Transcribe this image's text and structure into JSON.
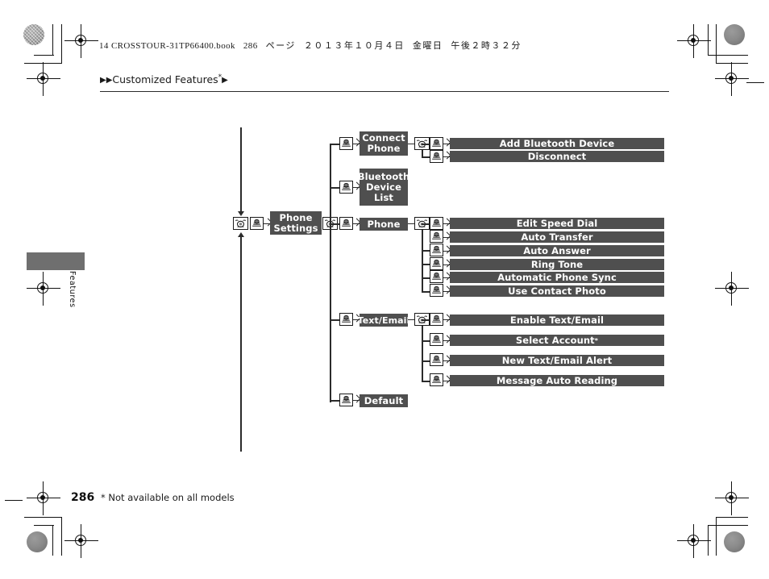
{
  "header": {
    "book_file": "14 CROSSTOUR-31TP66400.book",
    "page_label": "286",
    "page_unit_jp": "ページ",
    "date_jp": "２０１３年１０月４日",
    "weekday_jp": "金曜日",
    "time_jp": "午後２時３２分",
    "breadcrumb_prefix": "▶▶",
    "breadcrumb_title": "Customized Features",
    "breadcrumb_star": "*",
    "breadcrumb_suffix": "▶"
  },
  "side_tab": {
    "label": "Features"
  },
  "footer": {
    "page_number": "286",
    "footnote": "* Not available on all models"
  },
  "colors": {
    "node_fill": "#4f4f4f",
    "node_text": "#ffffff",
    "line": "#2b2b2b",
    "side_tab": "#6f6f6f"
  },
  "icons": {
    "dial": "rotary-dial-knob-icon",
    "push": "push-select-knob-icon",
    "chevron": "chevron-right-arrow-icon",
    "arrow_down": "arrow-down-icon",
    "arrow_up": "arrow-up-icon"
  },
  "diagram": {
    "root": {
      "label": "Phone\nSettings",
      "label_line1": "Phone",
      "label_line2": "Settings"
    },
    "level1": [
      {
        "id": "connect-phone",
        "label_line1": "Connect",
        "label_line2": "Phone",
        "lines": 2
      },
      {
        "id": "bluetooth-device-list",
        "label_line1": "Bluetooth",
        "label_line2": "Device",
        "label_line3": "List",
        "lines": 3
      },
      {
        "id": "phone",
        "label_line1": "Phone",
        "lines": 1
      },
      {
        "id": "text-email",
        "label_line1": "Text/Email",
        "lines": 1
      },
      {
        "id": "default",
        "label_line1": "Default",
        "lines": 1
      }
    ],
    "connect_phone_children": [
      {
        "id": "add-bluetooth-device",
        "label": "Add Bluetooth Device"
      },
      {
        "id": "disconnect",
        "label": "Disconnect"
      }
    ],
    "phone_children": [
      {
        "id": "edit-speed-dial",
        "label": "Edit Speed Dial"
      },
      {
        "id": "auto-transfer",
        "label": "Auto Transfer"
      },
      {
        "id": "auto-answer",
        "label": "Auto Answer"
      },
      {
        "id": "ring-tone",
        "label": "Ring Tone"
      },
      {
        "id": "automatic-phone-sync",
        "label": "Automatic Phone Sync"
      },
      {
        "id": "use-contact-photo",
        "label": "Use Contact Photo"
      }
    ],
    "text_email_children": [
      {
        "id": "enable-text-email",
        "label": "Enable Text/Email",
        "star": ""
      },
      {
        "id": "select-account",
        "label": "Select Account",
        "star": "*"
      },
      {
        "id": "new-text-email-alert",
        "label": "New Text/Email Alert",
        "star": ""
      },
      {
        "id": "message-auto-reading",
        "label": "Message Auto Reading",
        "star": ""
      }
    ]
  }
}
